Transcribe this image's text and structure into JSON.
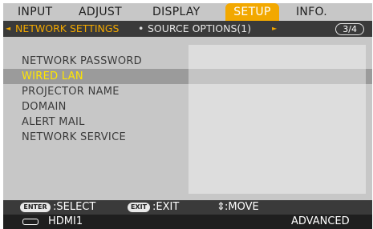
{
  "tabs": [
    {
      "label": "INPUT",
      "active": false
    },
    {
      "label": "ADJUST",
      "active": false
    },
    {
      "label": "DISPLAY",
      "active": false
    },
    {
      "label": "SETUP",
      "active": true
    },
    {
      "label": "INFO.",
      "active": false
    }
  ],
  "subnav": {
    "left_arrow": "◄",
    "active_label": "NETWORK SETTINGS",
    "separator": "•",
    "next_label": "SOURCE OPTIONS(1)",
    "right_arrow": "►",
    "page_indicator": "3/4"
  },
  "menu_items": [
    {
      "label": "NETWORK PASSWORD",
      "selected": false
    },
    {
      "label": "WIRED LAN",
      "selected": true
    },
    {
      "label": "PROJECTOR NAME",
      "selected": false
    },
    {
      "label": "DOMAIN",
      "selected": false
    },
    {
      "label": "ALERT MAIL",
      "selected": false
    },
    {
      "label": "NETWORK SERVICE",
      "selected": false
    }
  ],
  "help": {
    "enter_key": "ENTER",
    "enter_text": ":SELECT",
    "exit_key": "EXIT",
    "exit_text": ":EXIT",
    "move_symbol": "⇕",
    "move_text": ":MOVE"
  },
  "status": {
    "input_icon": "hdmi-connector-icon",
    "input_name": "HDMI1",
    "mode": "ADVANCED"
  },
  "colors": {
    "active_tab": "#f2a800",
    "selected_text": "#ffe600",
    "subbar_active_text": "#f2a800"
  }
}
